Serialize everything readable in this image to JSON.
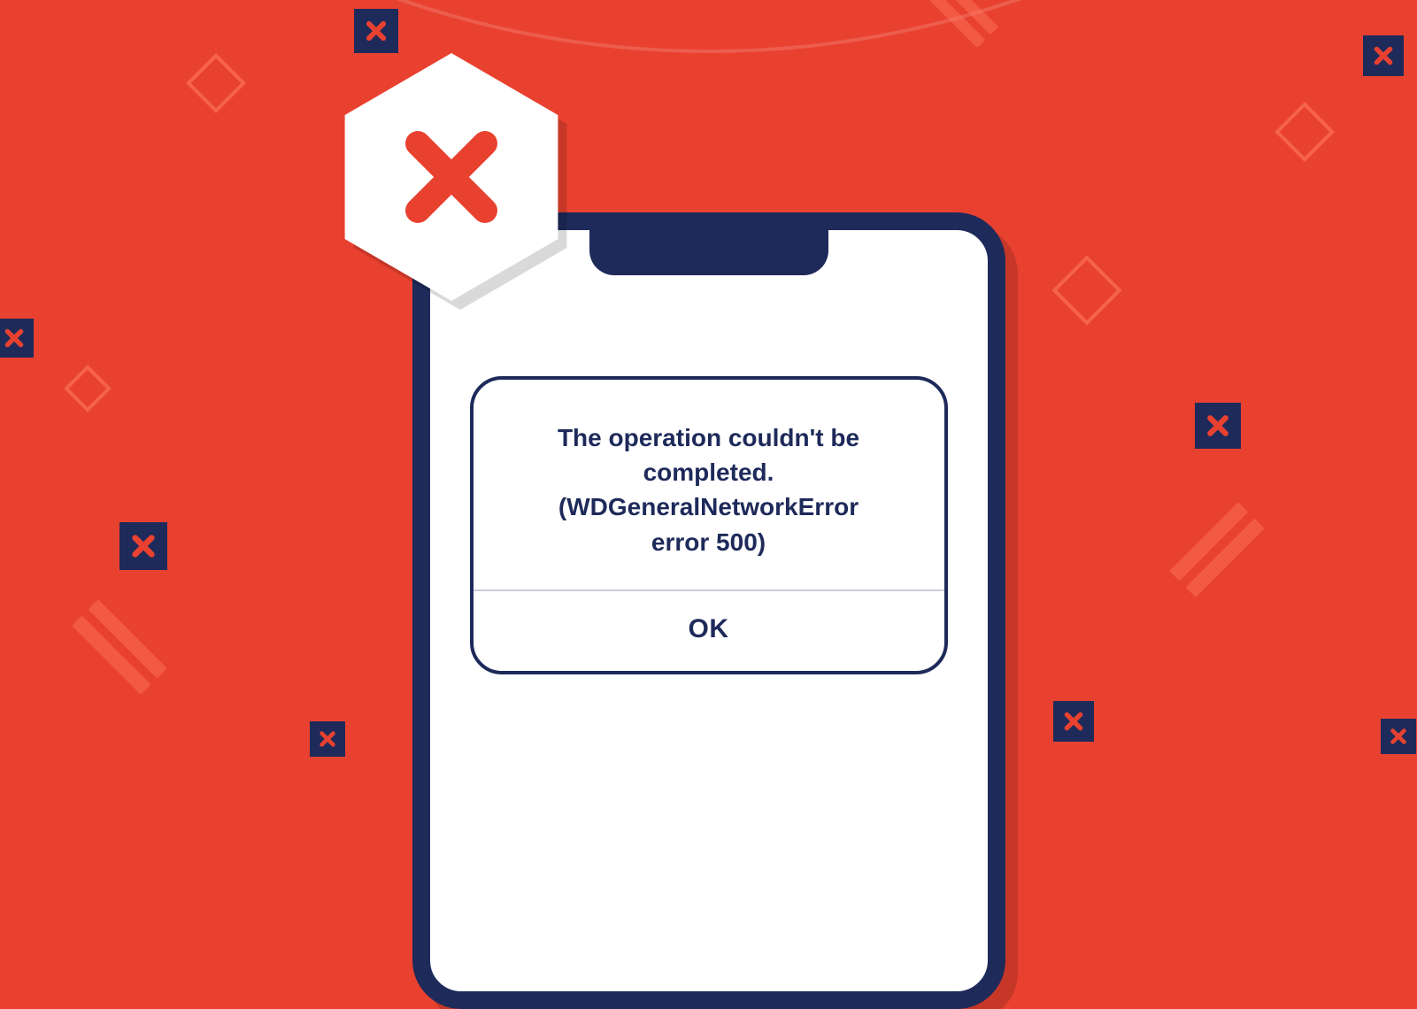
{
  "dialog": {
    "message": "The operation couldn't be\ncompleted.\n(WDGeneralNetworkError\nerror 500)",
    "button_label": "OK"
  },
  "colors": {
    "bg": "#e94130",
    "navy": "#1e2a5a",
    "red_accent": "#e94130"
  }
}
